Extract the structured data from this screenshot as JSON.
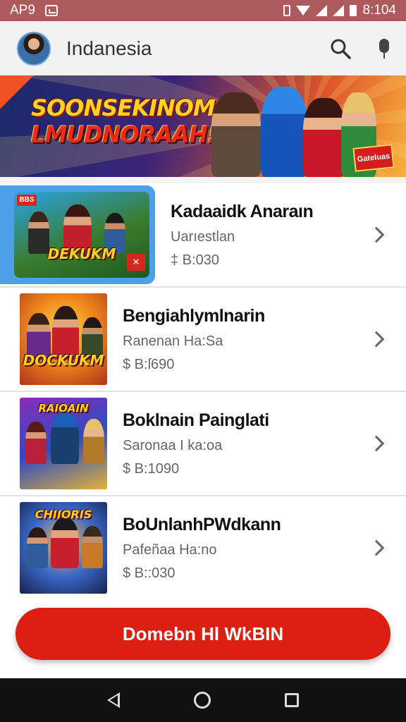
{
  "status_bar": {
    "left_text": "AP9",
    "time": "8:104"
  },
  "app_bar": {
    "title": "Indanesia",
    "search_icon": "search-icon",
    "mic_icon": "mic-icon"
  },
  "banner": {
    "line1": "SOONSEKINOM",
    "line2": "LMUDNORAAH!",
    "logo_text": "Gateluas"
  },
  "items": [
    {
      "name": "Kadaaidk Anaraın",
      "subtitle": "Uarıestlan",
      "price": "‡ B:030",
      "thumb_title": "DEKUKM",
      "corner": "BBS"
    },
    {
      "name": "Bengiahlymlnarin",
      "subtitle": "Ranenan Ha:Sa",
      "price": "$ B:ſ690",
      "thumb_title": "DOCKUKM"
    },
    {
      "name": "Boklnain Painglati",
      "subtitle": "Saronaa I ka:oa",
      "price": "$ B:1090",
      "thumb_title": "RAIOAIN"
    },
    {
      "name": "BoUnlanhPWdkann",
      "subtitle": "Pafeñaa Ha:no",
      "price": "$ B::030",
      "thumb_title": "CHIIORIS"
    }
  ],
  "cta": {
    "label": "Domebn Hl WkBIN"
  },
  "colors": {
    "status_bar": "#ad5a5c",
    "cta": "#dc1f10",
    "featured_frame": "#4da0e8"
  }
}
